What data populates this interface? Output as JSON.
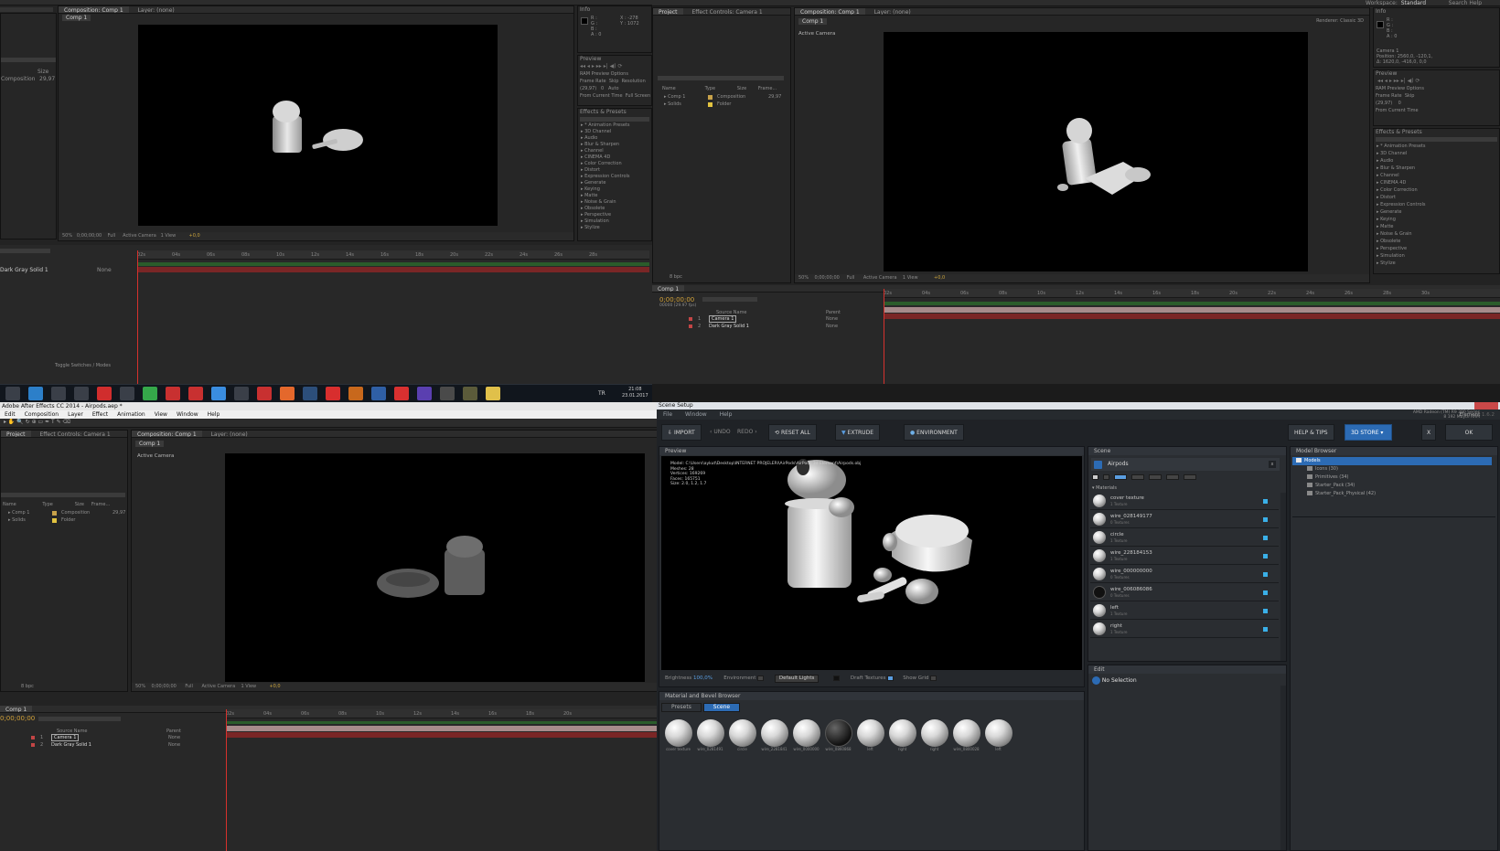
{
  "tl": {
    "tabs": [
      "Composition: Comp 1",
      "Layer: (none)"
    ],
    "comp_chip": "Comp 1",
    "info": {
      "title": "Info",
      "rgb": [
        "R :",
        "G :",
        "B :",
        "A : 0"
      ],
      "xy": [
        "X : -278",
        "Y : 1072"
      ]
    },
    "project_cols": [
      "Size",
      "Frame..."
    ],
    "project_rows": [
      {
        "name": "Composition",
        "val": "29,97"
      }
    ],
    "preview": {
      "title": "Preview",
      "ram": "RAM Preview Options",
      "labels": [
        "Frame Rate",
        "Skip",
        "Resolution"
      ],
      "values": [
        "(29,97)",
        "0",
        "Auto"
      ],
      "from": "From Current Time",
      "full": "Full Screen"
    },
    "effects_title": "Effects & Presets",
    "effects": [
      "* Animation Presets",
      "3D Channel",
      "Audio",
      "Blur & Sharpen",
      "Channel",
      "CINEMA 4D",
      "Color Correction",
      "Distort",
      "Expression Controls",
      "Generate",
      "Keying",
      "Matte",
      "Noise & Grain",
      "Obsolete",
      "Perspective",
      "Simulation",
      "Stylize"
    ],
    "viewer_ctrl": [
      "50%",
      "0;00;00;00",
      "Full",
      "Active Camera",
      "1 View",
      "+0,0"
    ],
    "ruler": [
      "02s",
      "04s",
      "06s",
      "08s",
      "10s",
      "12s",
      "14s",
      "16s",
      "18s",
      "20s",
      "22s",
      "24s",
      "26s",
      "28s"
    ],
    "layer": "Dark Gray Solid 1",
    "parent": "None"
  },
  "tr": {
    "top_tabs": [
      "Project",
      "Effect Controls: Camera 1"
    ],
    "comp_tabs": [
      "Composition: Comp 1",
      "Layer: (none)"
    ],
    "comp_chip": "Comp 1",
    "active_camera": "Active Camera",
    "renderer_label": "Renderer:",
    "renderer": "Classic 3D",
    "project_cols": [
      "Name",
      "Type",
      "Size",
      "Frame..."
    ],
    "project_rows": [
      {
        "name": "Comp 1",
        "type": "Composition",
        "val": "29,97",
        "color": "#c8a24a"
      },
      {
        "name": "Solids",
        "type": "Folder",
        "val": "",
        "color": "#e2c340"
      }
    ],
    "bpc": "8 bpc",
    "info": {
      "title": "Info",
      "lines": [
        "R :",
        "G :",
        "B :",
        "A : 0"
      ],
      "camera": "Camera 1",
      "position": "Position: 2560,0, -120,1,",
      "pos2": "Δ: 1620,0, -416,0, 0,0"
    },
    "preview": {
      "title": "Preview",
      "ram": "RAM Preview Options",
      "labels": [
        "Frame Rate",
        "Skip"
      ],
      "values": [
        "(29,97)",
        "0"
      ],
      "from": "From Current Time"
    },
    "effects_title": "Effects & Presets",
    "effects": [
      "* Animation Presets",
      "3D Channel",
      "Audio",
      "Blur & Sharpen",
      "Channel",
      "CINEMA 4D",
      "Color Correction",
      "Distort",
      "Expression Controls",
      "Generate",
      "Keying",
      "Matte",
      "Noise & Grain",
      "Obsolete",
      "Perspective",
      "Simulation",
      "Stylize"
    ],
    "viewer_ctrl": [
      "50%",
      "0;00;00;00",
      "Full",
      "Active Camera",
      "1 View",
      "+0,0"
    ],
    "timeline_tab": "Comp 1",
    "timecode": "0;00;00;00",
    "fps_line": "00000 (29.97 fps)",
    "cols": [
      "Source Name",
      "Parent"
    ],
    "layers": [
      {
        "num": "1",
        "name": "Camera 1",
        "parent": "None"
      },
      {
        "num": "2",
        "name": "Dark Gray Solid 1",
        "parent": "None"
      }
    ],
    "ruler": [
      "02s",
      "04s",
      "06s",
      "08s",
      "10s",
      "12s",
      "14s",
      "16s",
      "18s",
      "20s",
      "22s",
      "24s",
      "26s",
      "28s",
      "30s"
    ],
    "workspace_label": "Workspace:",
    "workspace": "Standard",
    "search": "Search Help"
  },
  "taskbar": {
    "lang": "TR",
    "time": "21:08",
    "date": "23.01.2017",
    "toggle": "Toggle Switches / Modes"
  },
  "bl": {
    "title": "Adobe After Effects CC 2014 - Airpods.aep *",
    "menu": [
      "Edit",
      "Composition",
      "Layer",
      "Effect",
      "Animation",
      "View",
      "Window",
      "Help"
    ],
    "left_tabs": [
      "Project",
      "Effect Controls: Camera 1"
    ],
    "comp_tabs": [
      "Composition: Comp 1",
      "Layer: (none)"
    ],
    "comp_chip": "Comp 1",
    "active_camera": "Active Camera",
    "project_cols": [
      "Name",
      "Type",
      "Size",
      "Frame..."
    ],
    "project_rows": [
      {
        "name": "Comp 1",
        "type": "Composition",
        "val": "29,97",
        "color": "#c8a24a"
      },
      {
        "name": "Solids",
        "type": "Folder",
        "val": "",
        "color": "#e2c340"
      }
    ],
    "bpc": "8 bpc",
    "viewer_ctrl": [
      "50%",
      "0;00;00;00",
      "Full",
      "Active Camera",
      "1 View",
      "+0,0"
    ],
    "timeline_tab": "Comp 1",
    "timecode": "0;00;00;00",
    "cols": [
      "Source Name",
      "Parent"
    ],
    "layers": [
      {
        "num": "1",
        "name": "Camera 1",
        "parent": "None"
      },
      {
        "num": "2",
        "name": "Dark Gray Solid 1",
        "parent": "None"
      }
    ],
    "ruler": [
      "02s",
      "04s",
      "06s",
      "08s",
      "10s",
      "12s",
      "14s",
      "16s",
      "18s",
      "20s"
    ]
  },
  "br": {
    "title": "Scene Setup",
    "menu": [
      "File",
      "Window",
      "Help"
    ],
    "gpu": "AMD Radeon (TM) R9 390 Series",
    "gpu2": "8 192 Mbyte RAM",
    "element_label": "Element",
    "element_ver": "1.6.2",
    "toolbar": {
      "import": "IMPORT",
      "undo": "UNDO",
      "redo": "REDO",
      "reset": "RESET ALL",
      "extrude": "EXTRUDE",
      "environment": "ENVIRONMENT",
      "help": "HELP & TIPS",
      "store": "3D STORE",
      "x": "X",
      "ok": "OK"
    },
    "preview_title": "Preview",
    "model_info": [
      "Model: C:\\Users\\aykut\\Desktop\\INTERNET PROJELERI\\AirPods\\AirPods 3d Element\\Airpods.obj",
      "Meshes: 28",
      "Vertices: 169269",
      "Faces: 165751",
      "Size: 2.0, 1.2, 1.7"
    ],
    "bottom_bar": {
      "brightness": "Brightness",
      "brightness_val": "100,0%",
      "environment": "Environment",
      "lights": "Default Lights",
      "draft": "Draft Textures",
      "grid": "Show Grid"
    },
    "browser_title": "Material and Bevel Browser",
    "browser_tabs": [
      "Presets",
      "Scene"
    ],
    "swatch_labels": [
      "cover texture",
      "wire_0281491",
      "circle",
      "wire_2281841",
      "wire_0000000",
      "wire_0860868",
      "left",
      "right",
      "right",
      "wire_0800028",
      "left"
    ],
    "scene_title": "Scene",
    "scene_item": "Airpods",
    "materials_label": "Materials",
    "materials": [
      {
        "name": "cover texture",
        "sub": "1 Texture"
      },
      {
        "name": "wire_028149177",
        "sub": "0 Textures"
      },
      {
        "name": "circle",
        "sub": "1 Texture"
      },
      {
        "name": "wire_228184153",
        "sub": "1 Texture"
      },
      {
        "name": "wire_000000000",
        "sub": "0 Textures"
      },
      {
        "name": "wire_006086086",
        "sub": "0 Textures"
      },
      {
        "name": "left",
        "sub": "1 Texture"
      },
      {
        "name": "right",
        "sub": "1 Texture"
      }
    ],
    "edit_title": "Edit",
    "no_selection": "No Selection",
    "model_browser_title": "Model Browser",
    "model_tree": [
      {
        "label": "Models",
        "level": 0
      },
      {
        "label": "Icons (30)",
        "level": 1
      },
      {
        "label": "Primitives (34)",
        "level": 1
      },
      {
        "label": "Starter_Pack (34)",
        "level": 1
      },
      {
        "label": "Starter_Pack_Physical (42)",
        "level": 1
      }
    ]
  }
}
